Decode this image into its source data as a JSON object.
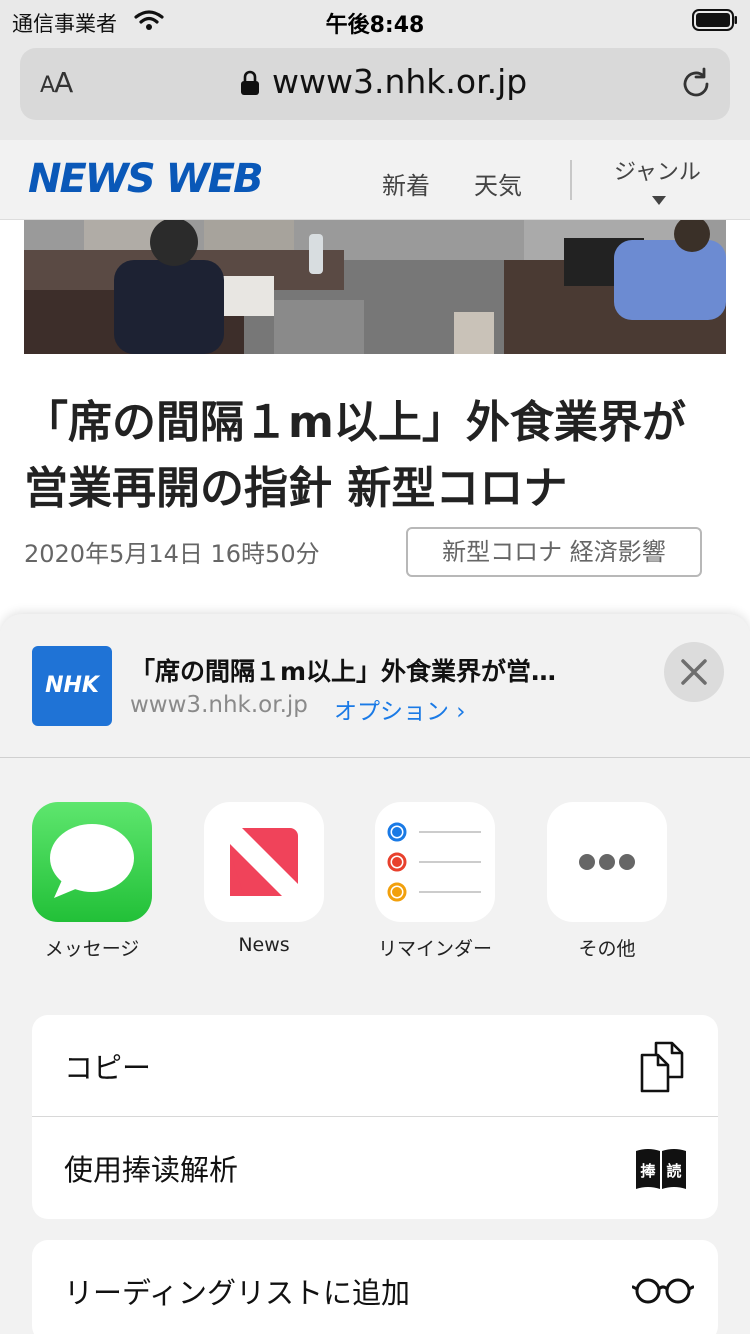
{
  "status_bar": {
    "carrier": "通信事業者",
    "time": "午後8:48"
  },
  "address_bar": {
    "text_size_button": "AA",
    "url": "www3.nhk.or.jp"
  },
  "site_header": {
    "logo": "NEWS WEB",
    "nav": [
      "新着",
      "天気",
      "ジャンル"
    ]
  },
  "article": {
    "title": "「席の間隔１m以上」外食業界が営業再開の指針 新型コロナ",
    "date": "2020年5月14日 16時50分",
    "tag": "新型コロナ 経済影響"
  },
  "share_sheet": {
    "site_icon_text": "NHK",
    "title": "「席の間隔１m以上」外食業界が営…",
    "domain": "www3.nhk.or.jp",
    "options_label": "オプション ›",
    "apps": [
      {
        "label": "メッセージ",
        "icon": "messages-icon"
      },
      {
        "label": "News",
        "icon": "news-icon"
      },
      {
        "label": "リマインダー",
        "icon": "reminders-icon"
      },
      {
        "label": "その他",
        "icon": "more-icon"
      }
    ],
    "actions_group1": [
      {
        "label": "コピー",
        "icon": "copy-icon"
      },
      {
        "label": "使用捧读解析",
        "icon": "reading-book-icon",
        "icon_text": [
          "捧",
          "読"
        ]
      }
    ],
    "actions_group2": [
      {
        "label": "リーディングリストに追加",
        "icon": "glasses-icon"
      }
    ]
  },
  "colors": {
    "accent": "#1a7ae6",
    "logo": "#0a58b8",
    "nhk": "#1f73d6",
    "messages": "#2ec94a",
    "news": "#f0435a"
  }
}
